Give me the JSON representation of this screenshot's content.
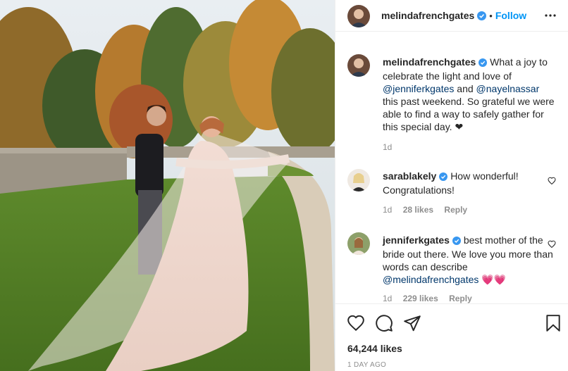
{
  "post": {
    "author": "melindafrenchgates",
    "follow_label": "Follow",
    "separator": "•",
    "caption": {
      "author": "melindafrenchgates",
      "text_1": "What a joy to celebrate the light and love of",
      "mention_1": "@jenniferkgates",
      "text_2": "and",
      "mention_2": "@nayelnassar",
      "text_3": "this past weekend. So grateful we were able to find a way to safely gather for this special day. ❤",
      "time": "1d"
    },
    "comments": [
      {
        "author": "sarablakely",
        "text": "How wonderful! Congratulations!",
        "time": "1d",
        "likes": "28 likes",
        "reply": "Reply"
      },
      {
        "author": "jenniferkgates",
        "text": "best mother of the bride out there. We love you more than words can describe",
        "mention": "@melindafrenchgates",
        "emoji": "💗💗",
        "time": "1d",
        "likes": "229 likes",
        "reply": "Reply"
      }
    ],
    "likes": "64,244 likes",
    "posted": "1 DAY AGO"
  },
  "colors": {
    "accent": "#0095f6",
    "mention": "#00376b",
    "muted": "#8e8e8e",
    "verified": "#3897f0"
  },
  "icons": [
    "verified-badge-icon",
    "more-options-icon",
    "heart-icon",
    "comment-icon",
    "share-icon",
    "save-icon"
  ]
}
